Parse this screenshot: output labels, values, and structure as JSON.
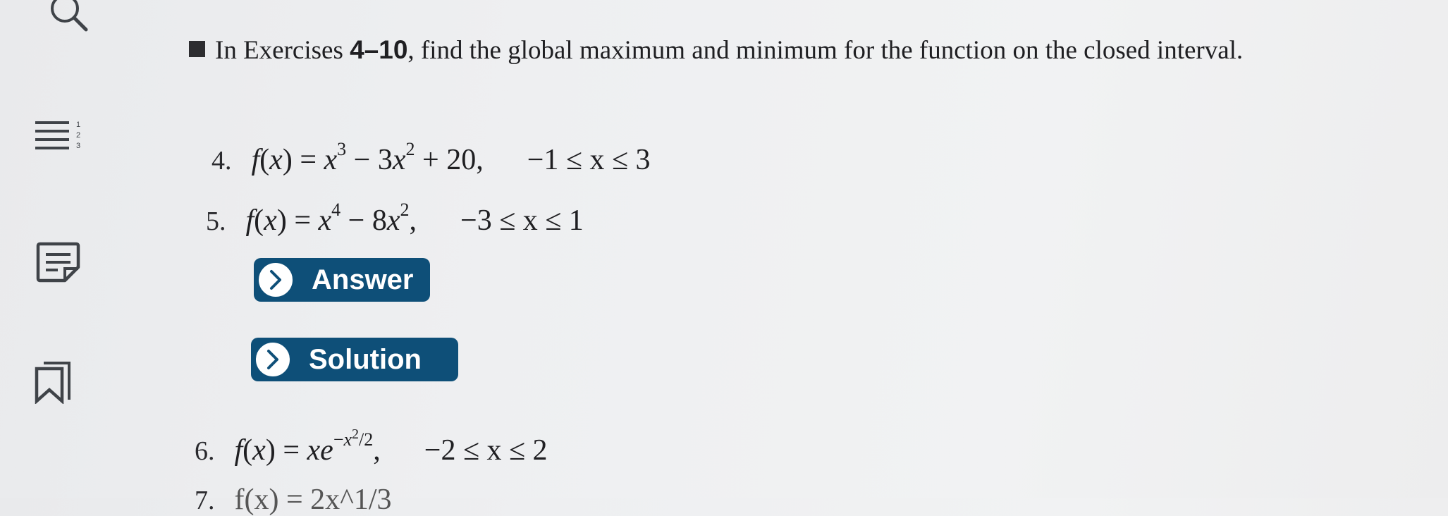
{
  "rail": {
    "icons": [
      "search-icon",
      "table-of-contents-icon",
      "notes-icon",
      "bookmark-icon"
    ]
  },
  "intro": {
    "prefix": "In Exercises ",
    "range": "4–10",
    "suffix": ", find the global maximum and minimum for the function on the closed interval."
  },
  "exercises": [
    {
      "number": "4.",
      "domain": "−1 ≤ x ≤ 3"
    },
    {
      "number": "5.",
      "domain": "−3 ≤ x ≤ 1"
    },
    {
      "number": "6.",
      "domain": "−2 ≤ x ≤ 2"
    },
    {
      "number": "7.",
      "partial": "f(x) = 2x^1/3"
    }
  ],
  "buttons": {
    "answer_label": "Answer",
    "solution_label": "Solution"
  },
  "colors": {
    "button_bg": "#0e4f78",
    "page_bg": "#eeeff1"
  }
}
